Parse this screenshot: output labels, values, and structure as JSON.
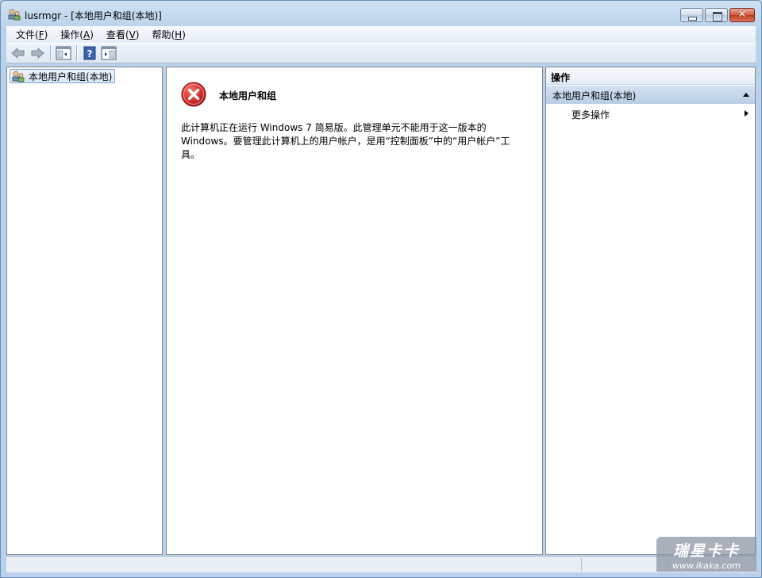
{
  "window": {
    "title": "lusrmgr - [本地用户和组(本地)]"
  },
  "menu": [
    {
      "label": "文件(",
      "key": "F",
      "suffix": ")"
    },
    {
      "label": "操作(",
      "key": "A",
      "suffix": ")"
    },
    {
      "label": "查看(",
      "key": "V",
      "suffix": ")"
    },
    {
      "label": "帮助(",
      "key": "H",
      "suffix": ")"
    }
  ],
  "toolbar": {
    "icons": [
      "back-arrow-icon",
      "forward-arrow-icon",
      "show-hide-console-tree-icon",
      "help-icon",
      "show-hide-action-pane-icon"
    ]
  },
  "tree": {
    "root_label": "本地用户和组(本地)"
  },
  "center": {
    "title": "本地用户和组",
    "message": "此计算机正在运行 Windows 7 简易版。此管理单元不能用于这一版本的 Windows。要管理此计算机上的用户帐户，是用“控制面板”中的“用户帐户”工具。"
  },
  "actions": {
    "header": "操作",
    "section_title": "本地用户和组(本地)",
    "items": [
      {
        "label": "更多操作"
      }
    ]
  },
  "watermark": {
    "main": "瑞星卡卡",
    "sub": "www.ikaka.com"
  },
  "colors": {
    "frame": "#b9d1ea",
    "error_red": "#d52b2b",
    "section_blue": "#c3d5ec"
  }
}
